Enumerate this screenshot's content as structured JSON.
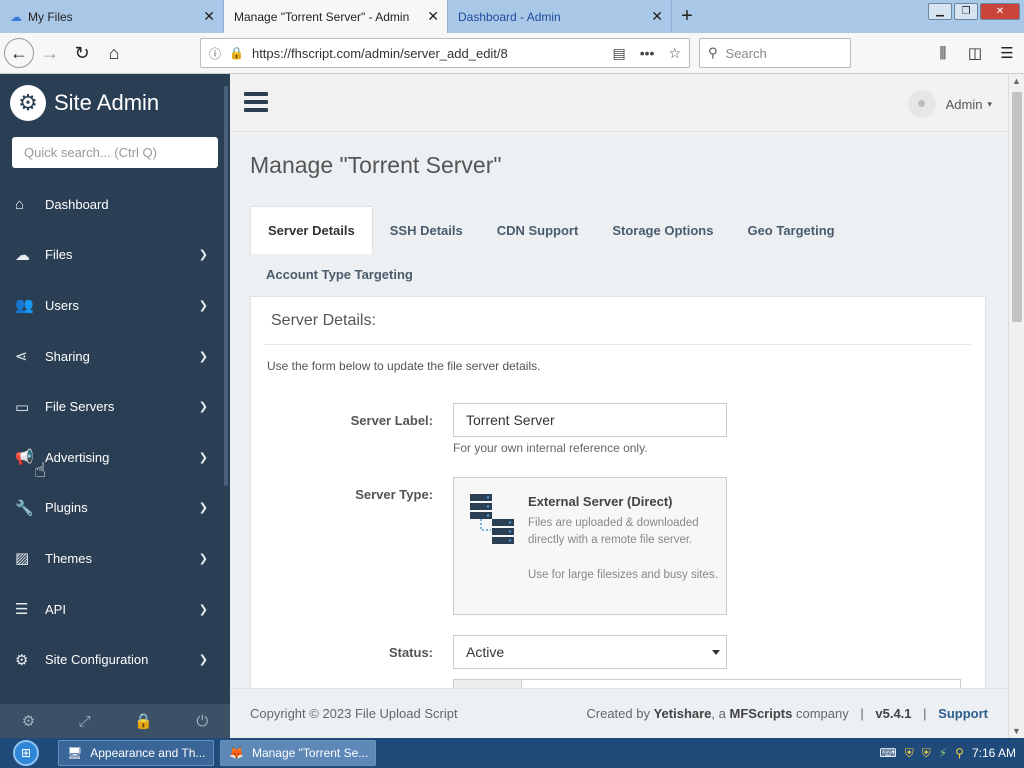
{
  "browser": {
    "tabs": [
      {
        "label": "My Files",
        "active": false
      },
      {
        "label": "Manage \"Torrent Server\" - Admin",
        "active": true
      },
      {
        "label": "Dashboard - Admin",
        "active": false
      }
    ],
    "url": "https://fhscript.com/admin/server_add_edit/8",
    "search_placeholder": "Search"
  },
  "sidebar": {
    "brand": "Site Admin",
    "search_placeholder": "Quick search... (Ctrl Q)",
    "items": [
      {
        "label": "Dashboard",
        "icon": "home-icon",
        "has_children": false
      },
      {
        "label": "Files",
        "icon": "cloud-upload-icon",
        "has_children": true
      },
      {
        "label": "Users",
        "icon": "users-icon",
        "has_children": true
      },
      {
        "label": "Sharing",
        "icon": "share-icon",
        "has_children": true
      },
      {
        "label": "File Servers",
        "icon": "hdd-icon",
        "has_children": true
      },
      {
        "label": "Advertising",
        "icon": "bullhorn-icon",
        "has_children": true
      },
      {
        "label": "Plugins",
        "icon": "wrench-icon",
        "has_children": true
      },
      {
        "label": "Themes",
        "icon": "image-icon",
        "has_children": true
      },
      {
        "label": "API",
        "icon": "database-icon",
        "has_children": true
      },
      {
        "label": "Site Configuration",
        "icon": "gear-icon",
        "has_children": true
      }
    ]
  },
  "header": {
    "user": "Admin"
  },
  "page": {
    "title": "Manage \"Torrent Server\"",
    "tabs": [
      "Server Details",
      "SSH Details",
      "CDN Support",
      "Storage Options",
      "Geo Targeting",
      "Account Type Targeting"
    ],
    "panel_title": "Server Details:",
    "intro": "Use the form below to update the file server details.",
    "form": {
      "server_label": {
        "label": "Server Label:",
        "value": "Torrent Server",
        "help": "For your own internal reference only."
      },
      "server_type": {
        "label": "Server Type:",
        "title": "External Server (Direct)",
        "desc": "Files are uploaded & downloaded directly with a remote file server.",
        "desc2": "Use for large filesizes and busy sites."
      },
      "status": {
        "label": "Status:",
        "value": "Active"
      }
    }
  },
  "footer": {
    "copyright": "Copyright © 2023 File Upload Script",
    "created_by": "Created by",
    "brand": "Yetishare",
    "company_pre": ", a",
    "company": "MFScripts",
    "company_post": "company",
    "version": "v5.4.1",
    "support": "Support"
  },
  "taskbar": {
    "items": [
      "Appearance and Th...",
      "Manage \"Torrent Se..."
    ],
    "clock": "7:16 AM"
  }
}
